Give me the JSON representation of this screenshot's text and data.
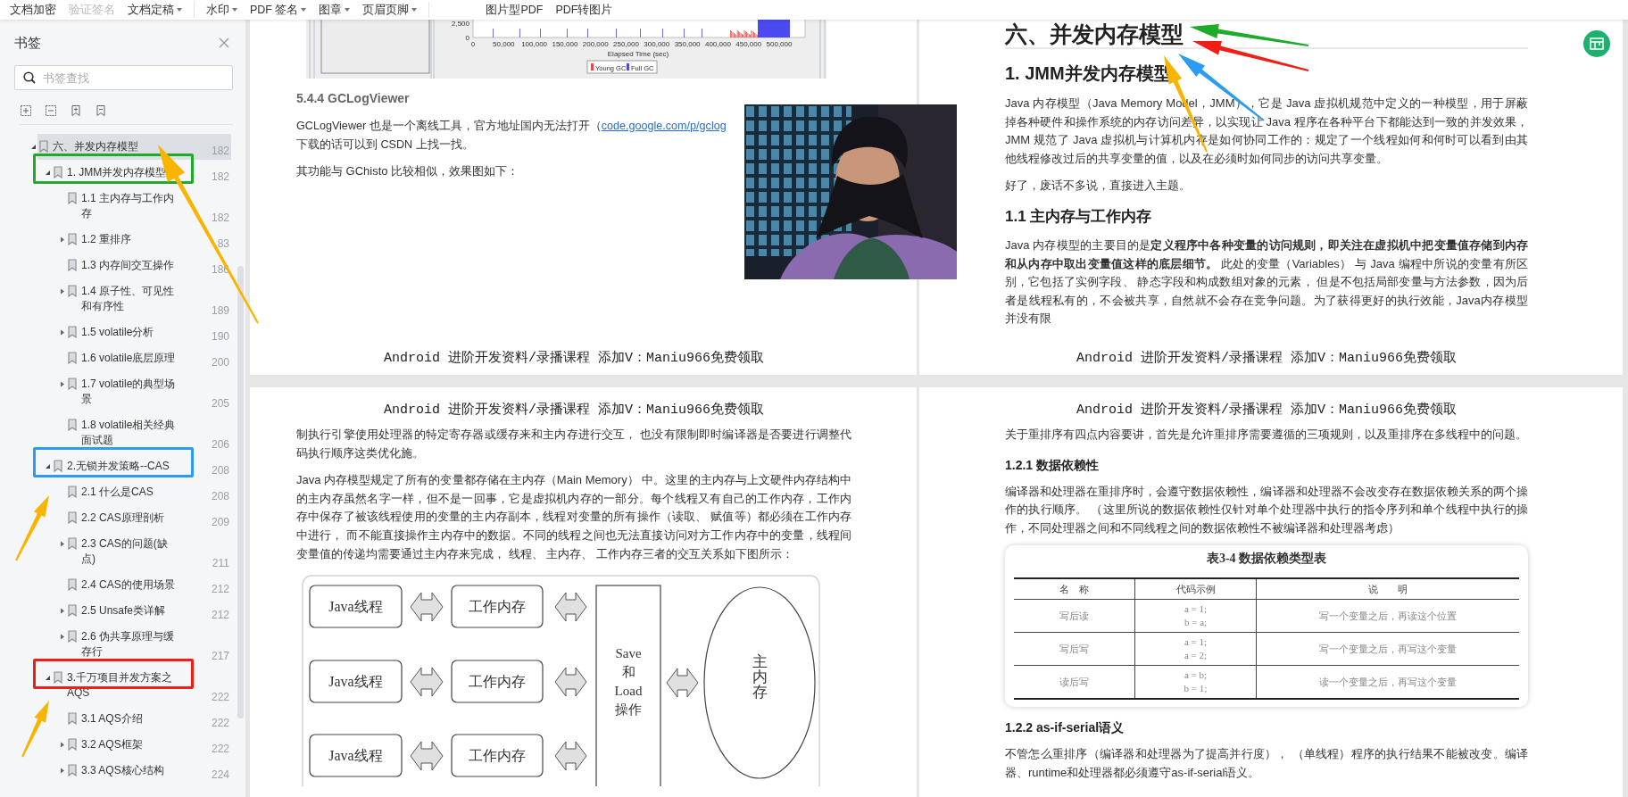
{
  "toolbar": {
    "groups": [
      {
        "items": [
          {
            "label": "文档加密",
            "disabled": false,
            "dropdown": false
          },
          {
            "label": "验证签名",
            "disabled": true,
            "dropdown": false
          },
          {
            "label": "文档定稿",
            "disabled": false,
            "dropdown": true
          }
        ]
      },
      {
        "items": [
          {
            "label": "水印",
            "disabled": false,
            "dropdown": true
          },
          {
            "label": "PDF 签名",
            "disabled": false,
            "dropdown": true
          },
          {
            "label": "图章",
            "disabled": false,
            "dropdown": true
          },
          {
            "label": "页眉页脚",
            "disabled": false,
            "dropdown": true
          }
        ]
      },
      {
        "items": [
          {
            "label": "图片型PDF",
            "disabled": false,
            "dropdown": false
          },
          {
            "label": "PDF转图片",
            "disabled": false,
            "dropdown": false
          }
        ]
      }
    ]
  },
  "bookmarks": {
    "title": "书签",
    "search": {
      "placeholder": "书签查找"
    },
    "items": [
      {
        "title": "六、并发内存模型",
        "page": "182",
        "selected": true,
        "expanded": true,
        "children": [
          {
            "title": "1. JMM并发内存模型",
            "page": "182",
            "selected": false,
            "expanded": true,
            "color": "#1faa2a",
            "children": [
              {
                "title": "1.1 主内存与工作内存",
                "page": "182",
                "selected": false
              },
              {
                "title": "1.2 重排序",
                "page": "83",
                "selected": false,
                "expanded": false
              },
              {
                "title": "1.3 内存间交互操作",
                "page": "186",
                "selected": false
              },
              {
                "title": "1.4 原子性、可见性和有序性",
                "page": "189",
                "selected": false,
                "expanded": false
              },
              {
                "title": "1.5 volatile分析",
                "page": "190",
                "selected": false,
                "expanded": false
              },
              {
                "title": "1.6 volatile底层原理",
                "page": "200",
                "selected": false
              },
              {
                "title": "1.7 volatile的典型场景",
                "page": "205",
                "selected": false,
                "expanded": false
              },
              {
                "title": "1.8 volatile相关经典面试题",
                "page": "206",
                "selected": false
              }
            ]
          },
          {
            "title": "2.无锁并发策略--CAS",
            "page": "208",
            "selected": false,
            "expanded": true,
            "color": "#2b9cf2",
            "children": [
              {
                "title": "2.1 什么是CAS",
                "page": "208",
                "selected": false
              },
              {
                "title": "2.2 CAS原理剖析",
                "page": "209",
                "selected": false
              },
              {
                "title": "2.3 CAS的问题(缺点)",
                "page": "211",
                "selected": false,
                "expanded": false
              },
              {
                "title": "2.4 CAS的使用场景",
                "page": "212",
                "selected": false
              },
              {
                "title": "2.5 Unsafe类详解",
                "page": "212",
                "selected": false,
                "expanded": false
              },
              {
                "title": "2.6 伪共享原理与缓存行",
                "page": "217",
                "selected": false,
                "expanded": false
              }
            ]
          },
          {
            "title": "3.千万项目并发方案之AQS",
            "page": "222",
            "selected": false,
            "expanded": true,
            "color": "#f01e14",
            "children": [
              {
                "title": "3.1 AQS介绍",
                "page": "222",
                "selected": false
              },
              {
                "title": "3.2 AQS框架",
                "page": "222",
                "selected": false,
                "expanded": false
              },
              {
                "title": "3.3 AQS核心结构",
                "page": "224",
                "selected": false,
                "expanded": false
              }
            ]
          }
        ]
      }
    ]
  },
  "pages": [
    {
      "blocks": [
        {
          "kind": "gc_chart",
          "y_ticks": [
            "2,500",
            "0"
          ],
          "x_ticks": [
            "0",
            "50,000",
            "100,000",
            "150,000",
            "200,000",
            "250,000",
            "300,000",
            "350,000",
            "400,000",
            "450,000",
            "500,000"
          ],
          "xlabel": "Elapsed Time (sec)",
          "legend": [
            {
              "label": "Young GC",
              "color": "#e84848"
            },
            {
              "label": "Full GC",
              "color": "#4a4af0"
            }
          ]
        },
        {
          "kind": "subheading",
          "text": "5.4.4 GCLogViewer"
        },
        {
          "kind": "link_paragraph",
          "before": "GCLogViewer 也是一个离线工具，官方地址国内无法打开（",
          "link": "code.google.com/p/gclog",
          "after": "下载的话可以到 CSDN 上找一找。"
        },
        {
          "kind": "paragraph",
          "text": "其功能与 GChisto 比较相似，效果图如下："
        },
        {
          "kind": "footer",
          "text": "Android 进阶开发资料/录播课程 添加V：Maniu966免费领取"
        }
      ]
    },
    {
      "blocks": [
        {
          "kind": "heading1",
          "text": "六、并发内存模型"
        },
        {
          "kind": "heading2",
          "text": "1. JMM并发内存模型"
        },
        {
          "kind": "paragraph",
          "text": " Java 内存模型（Java Memory Model，JMM），它是 Java 虚拟机规范中定义的一种模型，用于屏蔽掉各种硬件和操作系统的内存访问差异，以实现让 Java 程序在各种平台下都能达到一致的并发效果，JMM 规范了 Java 虚拟机与计算机内存是如何协同工作的：规定了一个线程如何和何时可以看到由其他线程修改过后的共享变量的值，以及在必须时如何同步的访问共享变量。"
        },
        {
          "kind": "paragraph",
          "text": "好了，废话不多说，直接进入主题。"
        },
        {
          "kind": "heading3",
          "text": "1.1 主内存与工作内存"
        },
        {
          "kind": "paragraph",
          "text": "Java 内存模型的主要目的是**定义程序中各种变量的访问规则，即关注在虚拟机中把变量值存储到内存和从内存中取出变量值这样的底层细节。** 此处的变量（Variables） 与 Java 编程中所说的变量有所区别，它包括了实例字段、 静态字段和构成数组对象的元素， 但是不包括局部变量与方法参数，因为后者是线程私有的，不会被共享，自然就不会存在竞争问题。为了获得更好的执行效能，Java内存模型并没有限"
        },
        {
          "kind": "footer",
          "text": "Android 进阶开发资料/录播课程 添加V：Maniu966免费领取"
        }
      ]
    },
    {
      "blocks": [
        {
          "kind": "header",
          "text": "Android 进阶开发资料/录播课程 添加V：Maniu966免费领取"
        },
        {
          "kind": "paragraph",
          "text": "制执行引擎使用处理器的特定寄存器或缓存来和主内存进行交互， 也没有限制即时编译器是否要进行调整代码执行顺序这类优化施。"
        },
        {
          "kind": "paragraph",
          "text": "Java 内存模型规定了所有的变量都存储在主内存（Main Memory） 中。这里的主内存与上文硬件内存结构中的主内存虽然名字一样，但不是一回事，它是虚拟机内存的一部分。每个线程又有自己的工作内存，工作内存中保存了被该线程使用的变量的主内存副本，线程对变量的所有操作（读取、 赋值等）都必须在工作内存中进行， 而不能直接操作主内存中的数据。不同的线程之间也无法直接访问对方工作内存中的变量，线程间变量值的传递均需要通过主内存来完成， 线程、 主内存、 工作内存三者的交互关系如下图所示："
        },
        {
          "kind": "memory_diagram",
          "threads": [
            "Java线程",
            "Java线程",
            "Java线程"
          ],
          "working": [
            "工作内存",
            "工作内存",
            "工作内存"
          ],
          "save_load": [
            "Save",
            "和",
            "Load",
            "操作"
          ],
          "main_memory": "主内存"
        }
      ]
    },
    {
      "blocks": [
        {
          "kind": "header",
          "text": "Android 进阶开发资料/录播课程 添加V：Maniu966免费领取"
        },
        {
          "kind": "paragraph",
          "text": "关于重排序有四点内容要讲，首先是允许重排序需要遵循的三项规则，以及重排序在多线程中的问题。"
        },
        {
          "kind": "heading4",
          "text": "1.2.1 数据依赖性"
        },
        {
          "kind": "paragraph",
          "text": "编译器和处理器在重排序时，会遵守数据依赖性，编译器和处理器不会改变存在数据依赖关系的两个操作的执行顺序。 （这里所说的数据依赖性仅针对单个处理器中执行的指令序列和单个线程中执行的操作，不同处理器之间和不同线程之间的数据依赖性不被编译器和处理器考虑）"
        },
        {
          "kind": "table_image",
          "title": "表3-4  数据依赖类型表",
          "columns": [
            "名　称",
            "代码示例",
            "说　　明"
          ],
          "rows": [
            [
              "写后读",
              "a = 1;\nb = a;",
              "写一个变量之后，再读这个位置"
            ],
            [
              "写后写",
              "a = 1;\na = 2;",
              "写一个变量之后，再写这个变量"
            ],
            [
              "读后写",
              "a = b;\nb = 1;",
              "读一个变量之后，再写这个变量"
            ]
          ]
        },
        {
          "kind": "heading4",
          "text": "1.2.2 as-if-serial语义"
        },
        {
          "kind": "paragraph",
          "text": "不管怎么重排序（编译器和处理器为了提高并行度）， （单线程）程序的执行结果不能被改变。编译器、runtime和处理器都必须遵守as-if-serial语义。"
        }
      ]
    }
  ],
  "arrows": [
    {
      "color": "#f9b400"
    },
    {
      "color": "#f9b400"
    },
    {
      "color": "#f9b400"
    },
    {
      "color": "#1faa2a"
    },
    {
      "color": "#f01e14"
    },
    {
      "color": "#2b9cf2"
    },
    {
      "color": "#f9b400"
    }
  ]
}
